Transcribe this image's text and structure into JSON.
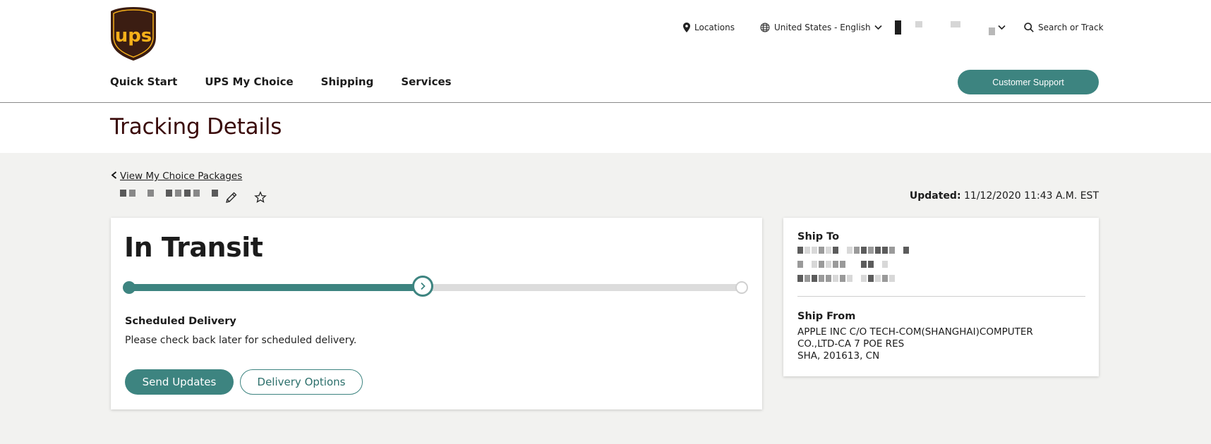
{
  "header": {
    "locations_label": "Locations",
    "language_label": "United States - English",
    "search_label": "Search or Track",
    "nav": [
      "Quick Start",
      "UPS My Choice",
      "Shipping",
      "Services"
    ],
    "customer_support_label": "Customer Support"
  },
  "brand": {
    "logo_text": "ups",
    "accent_color": "#3d8480",
    "title_color": "#3a0a0a",
    "logo_brown": "#3b1d12",
    "logo_gold": "#f6b01a"
  },
  "page": {
    "title": "Tracking Details",
    "back_link": "View My Choice Packages",
    "updated_label": "Updated:",
    "updated_value": "11/12/2020 11:43 A.M. EST"
  },
  "tracking": {
    "status": "In Transit",
    "progress": 0.48,
    "scheduled_title": "Scheduled Delivery",
    "scheduled_text": "Please check back later for scheduled delivery.",
    "send_updates_label": "Send Updates",
    "delivery_options_label": "Delivery Options"
  },
  "ship": {
    "to_label": "Ship To",
    "from_label": "Ship From",
    "from_lines": [
      "APPLE INC C/O TECH-COM(SHANGHAI)COMPUTER",
      "CO.,LTD-CA 7 POE RES",
      "SHA, 201613, CN"
    ]
  },
  "icons": [
    "location-pin-icon",
    "globe-icon",
    "chevron-down-icon",
    "search-icon",
    "pencil-icon",
    "star-icon",
    "chevron-right-icon",
    "chevron-left-icon"
  ]
}
